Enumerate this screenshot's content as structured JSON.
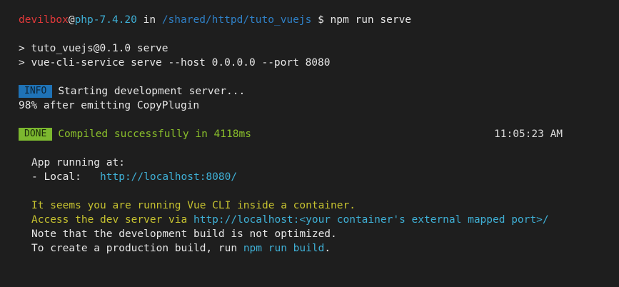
{
  "prompt": {
    "user": "devilbox",
    "at": "@",
    "host": "php-7.4.20",
    "in": "in",
    "path": "/shared/httpd/tuto_vuejs",
    "symbol": "$",
    "command": "npm run serve"
  },
  "npm_output": {
    "line1": "> tuto_vuejs@0.1.0 serve",
    "line2": "> vue-cli-service serve --host 0.0.0.0 --port 8080"
  },
  "info": {
    "badge": "INFO",
    "message": "Starting development server..."
  },
  "progress": "98% after emitting CopyPlugin",
  "done": {
    "badge": "DONE",
    "message": "Compiled successfully in 4118ms",
    "time": "11:05:23 AM"
  },
  "app": {
    "running": "App running at:",
    "local_label": "- Local:   ",
    "local_url": "http://localhost:8080/"
  },
  "container_note": {
    "line1": "It seems you are running Vue CLI inside a container.",
    "line2_prefix": "Access the dev server via ",
    "line2_url": "http://localhost:<your container's external mapped port>/",
    "line3": "Note that the development build is not optimized.",
    "line4_prefix": "To create a production build, run ",
    "line4_cmd": "npm run build",
    "line4_suffix": "."
  },
  "colors": {
    "background": "#1e1e1e",
    "user": "#e0393a",
    "host": "#3fb0d6",
    "path": "#2f80c6",
    "warning": "#c6c230",
    "success": "#8abf2b",
    "info_badge": "#1f73b7",
    "done_badge": "#7cb82f"
  }
}
